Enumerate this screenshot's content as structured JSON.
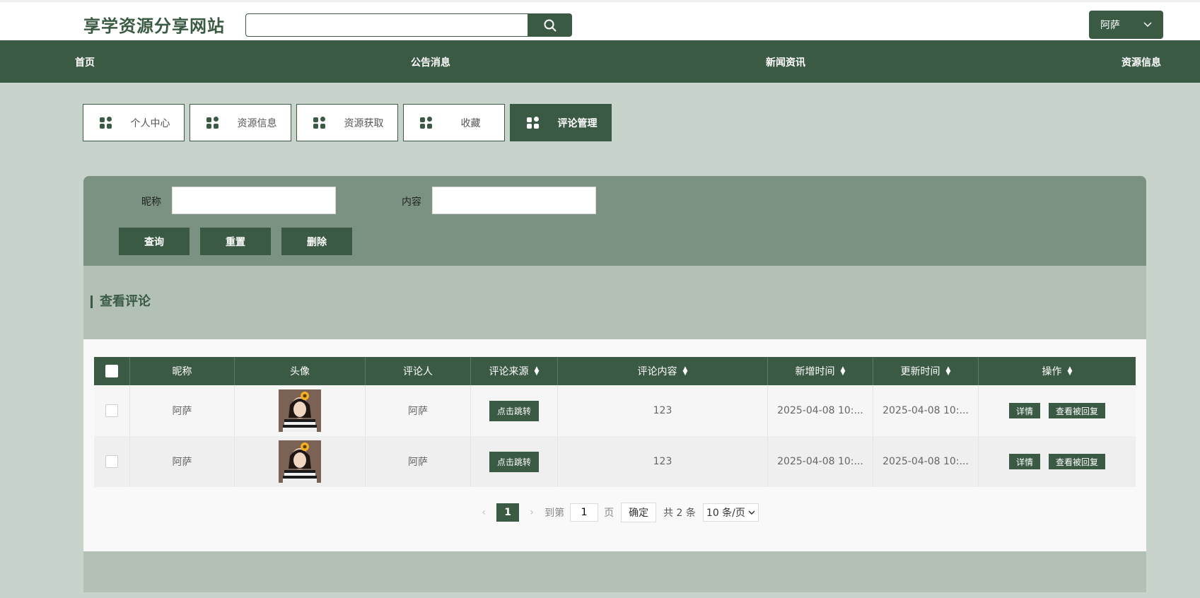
{
  "header": {
    "site_title": "享学资源分享网站",
    "search_placeholder": "",
    "user_name": "阿萨"
  },
  "nav": {
    "items": [
      "首页",
      "公告消息",
      "新闻资讯",
      "资源信息"
    ]
  },
  "tabs": [
    {
      "label": "个人中心",
      "active": false
    },
    {
      "label": "资源信息",
      "active": false
    },
    {
      "label": "资源获取",
      "active": false
    },
    {
      "label": "收藏",
      "active": false
    },
    {
      "label": "评论管理",
      "active": true
    }
  ],
  "filter": {
    "nickname_label": "昵称",
    "nickname_value": "",
    "content_label": "内容",
    "content_value": "",
    "query_label": "查询",
    "reset_label": "重置",
    "delete_label": "删除"
  },
  "section": {
    "title": "查看评论"
  },
  "table": {
    "columns": [
      "昵称",
      "头像",
      "评论人",
      "评论来源",
      "评论内容",
      "新增时间",
      "更新时间",
      "操作"
    ],
    "rows": [
      {
        "nickname": "阿萨",
        "commenter": "阿萨",
        "source_btn": "点击跳转",
        "content": "123",
        "created": "2025-04-08 10:...",
        "updated": "2025-04-08 10:...",
        "detail_btn": "详情",
        "reply_btn": "查看被回复"
      },
      {
        "nickname": "阿萨",
        "commenter": "阿萨",
        "source_btn": "点击跳转",
        "content": "123",
        "created": "2025-04-08 10:...",
        "updated": "2025-04-08 10:...",
        "detail_btn": "详情",
        "reply_btn": "查看被回复"
      }
    ]
  },
  "pagination": {
    "current_page": "1",
    "goto_label": "到第",
    "goto_value": "1",
    "page_unit": "页",
    "confirm_label": "确定",
    "total_text": "共 2 条",
    "page_size": "10 条/页"
  },
  "colors": {
    "primary": "#3a5a44",
    "background": "#c8d3cb",
    "filter_panel": "#7b9282",
    "section": "#b3c0b6"
  }
}
